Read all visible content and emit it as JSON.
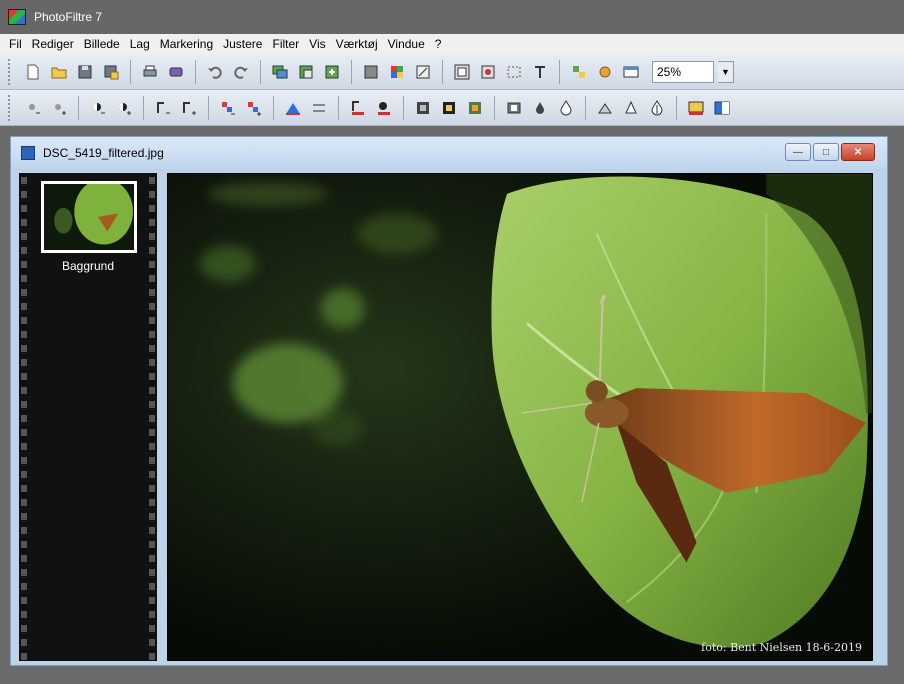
{
  "app": {
    "title": "PhotoFiltre 7"
  },
  "menu": [
    "Fil",
    "Rediger",
    "Billede",
    "Lag",
    "Markering",
    "Justere",
    "Filter",
    "Vis",
    "Værktøj",
    "Vindue",
    "?"
  ],
  "toolbar": {
    "zoom_value": "25%"
  },
  "document": {
    "title": "DSC_5419_filtered.jpg",
    "layer_name": "Baggrund",
    "watermark": "foto: Bent Nielsen 18-6-2019"
  }
}
